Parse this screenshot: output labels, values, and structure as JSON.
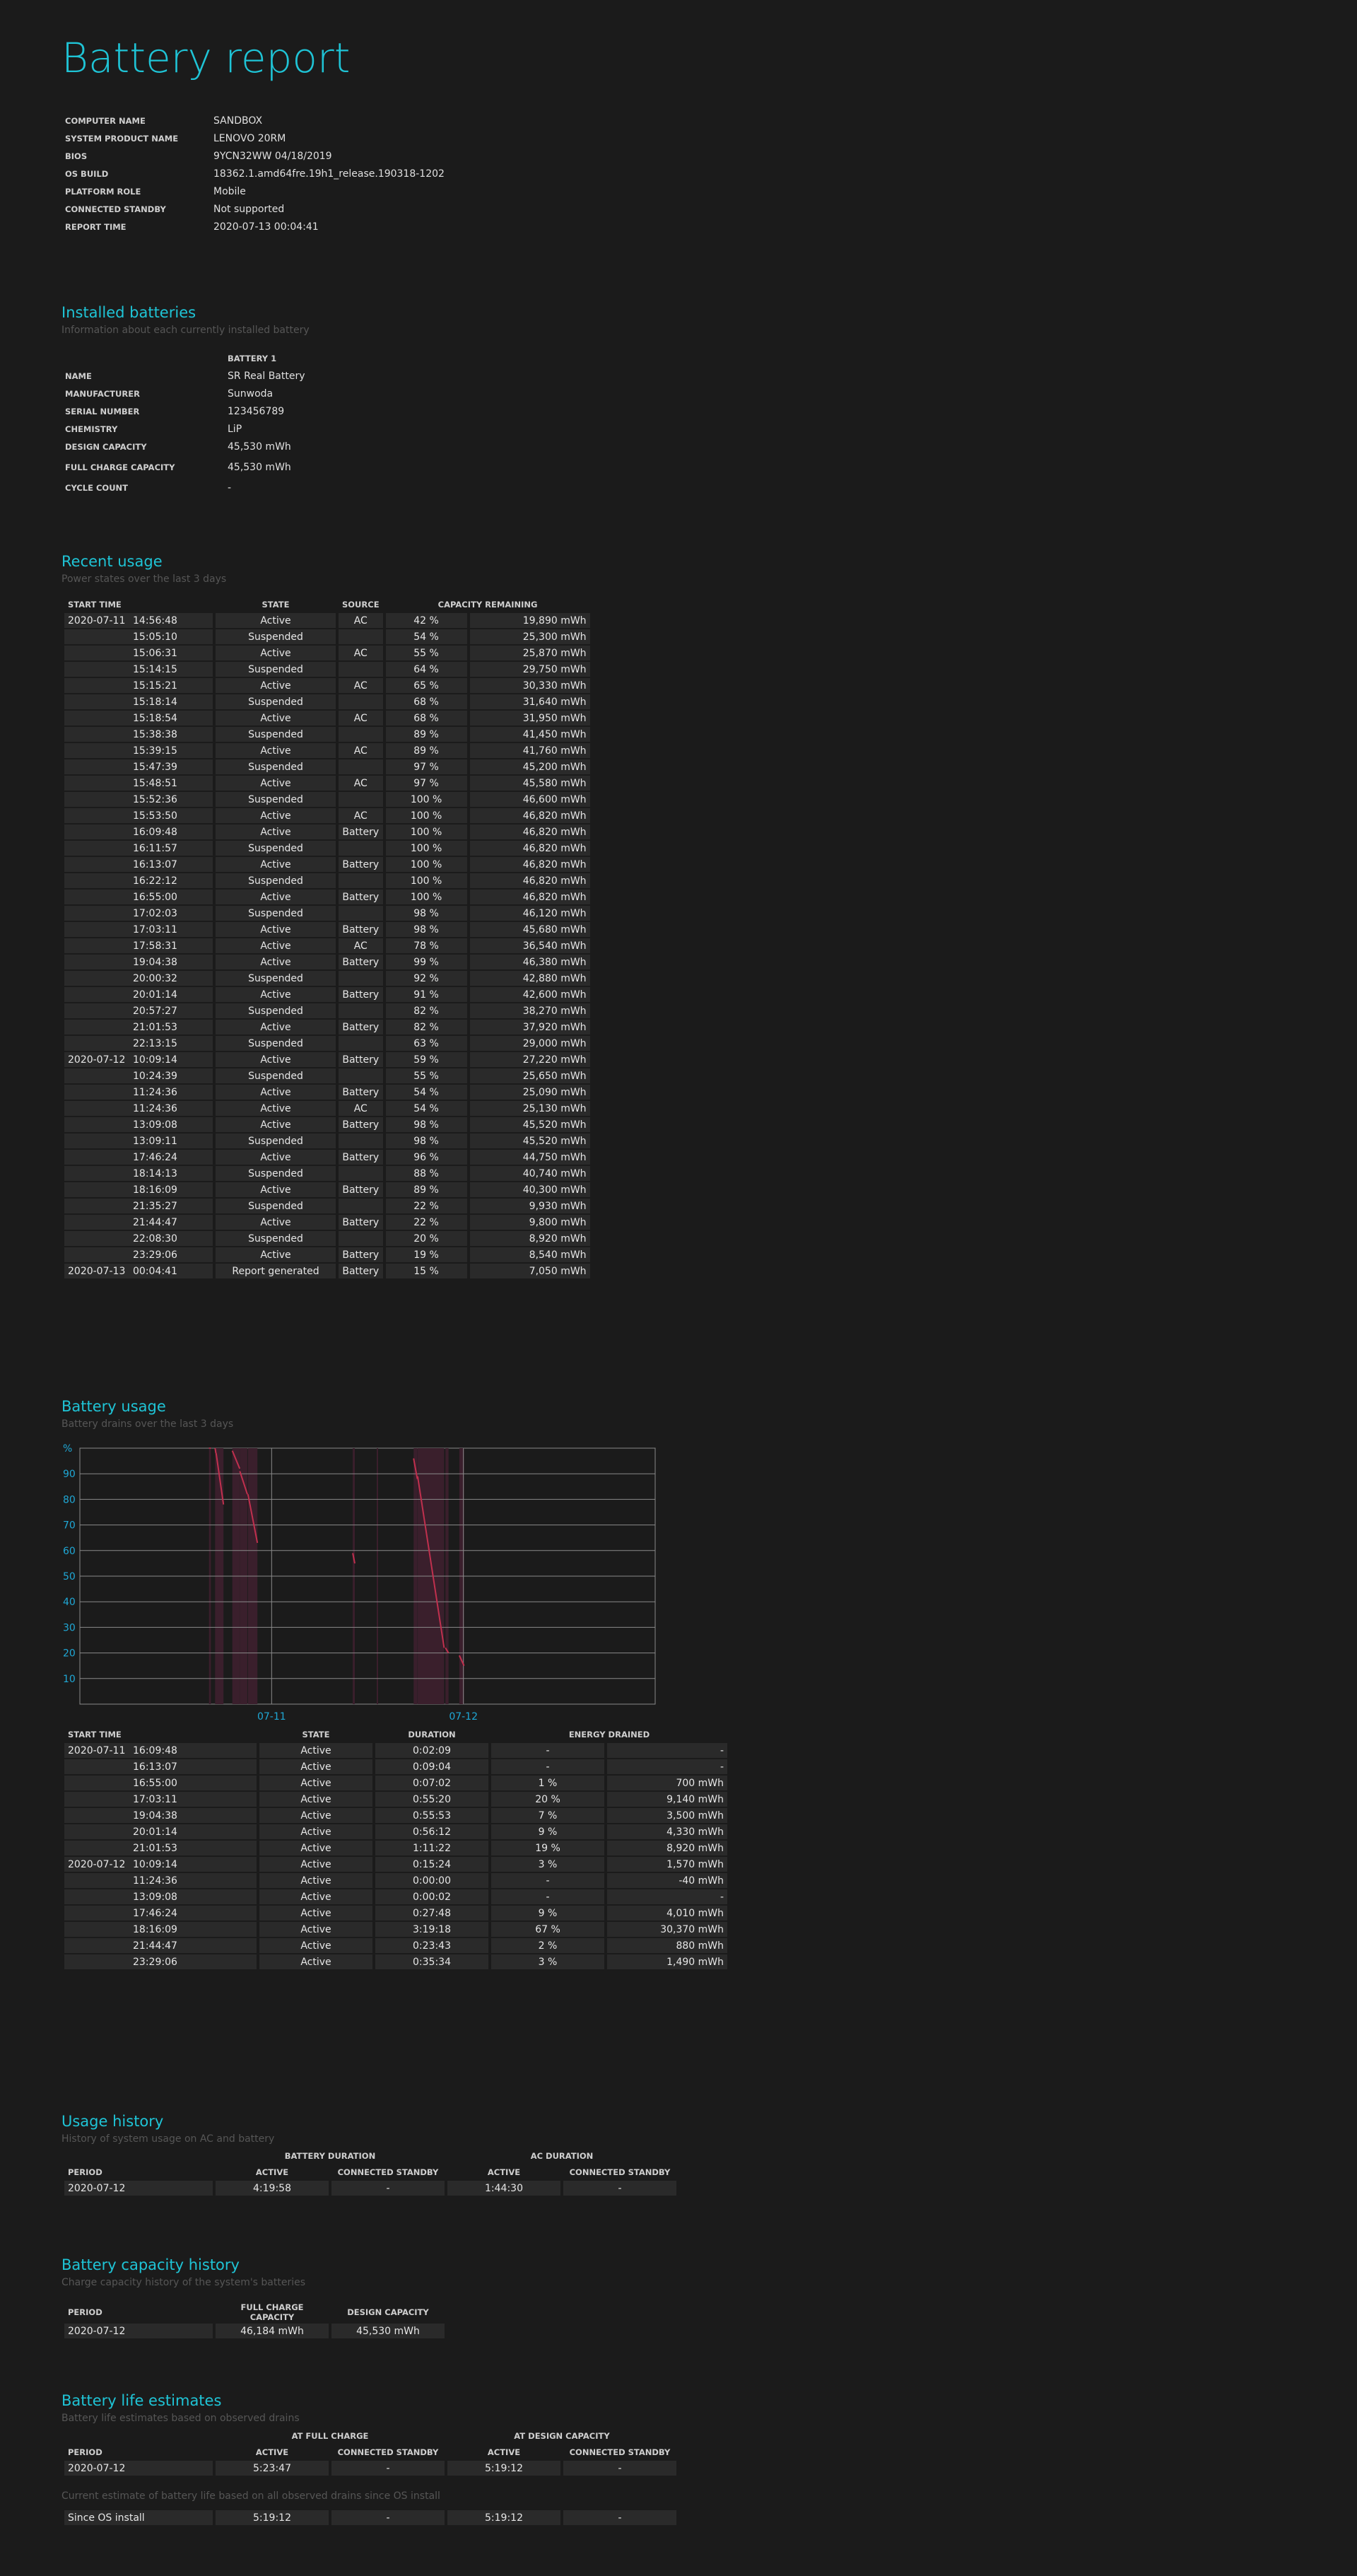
{
  "title": "Battery report",
  "system_info": [
    {
      "label": "COMPUTER NAME",
      "value": "SANDBOX"
    },
    {
      "label": "SYSTEM PRODUCT NAME",
      "value": "LENOVO 20RM"
    },
    {
      "label": "BIOS",
      "value": "9YCN32WW 04/18/2019"
    },
    {
      "label": "OS BUILD",
      "value": "18362.1.amd64fre.19h1_release.190318-1202"
    },
    {
      "label": "PLATFORM ROLE",
      "value": "Mobile"
    },
    {
      "label": "CONNECTED STANDBY",
      "value": "Not supported"
    },
    {
      "label": "REPORT TIME",
      "value": "2020-07-13   00:04:41"
    }
  ],
  "installed": {
    "title": "Installed batteries",
    "subtitle": "Information about each currently installed battery",
    "header": "BATTERY 1",
    "rows": [
      {
        "label": "NAME",
        "value": "SR Real Battery"
      },
      {
        "label": "MANUFACTURER",
        "value": "Sunwoda"
      },
      {
        "label": "SERIAL NUMBER",
        "value": "123456789"
      },
      {
        "label": "CHEMISTRY",
        "value": "LiP"
      },
      {
        "label": "DESIGN CAPACITY",
        "value": "45,530 mWh"
      },
      {
        "label": "FULL CHARGE CAPACITY",
        "value": "45,530 mWh"
      },
      {
        "label": "CYCLE COUNT",
        "value": "-"
      }
    ]
  },
  "recent": {
    "title": "Recent usage",
    "subtitle": "Power states over the last 3 days",
    "headers": [
      "START TIME",
      "STATE",
      "SOURCE",
      "CAPACITY REMAINING"
    ],
    "rows": [
      {
        "date": "2020-07-11",
        "time": "14:56:48",
        "state": "Active",
        "source": "AC",
        "pct": "42 %",
        "mwh": "19,890 mWh"
      },
      {
        "date": "",
        "time": "15:05:10",
        "state": "Suspended",
        "source": "",
        "pct": "54 %",
        "mwh": "25,300 mWh"
      },
      {
        "date": "",
        "time": "15:06:31",
        "state": "Active",
        "source": "AC",
        "pct": "55 %",
        "mwh": "25,870 mWh"
      },
      {
        "date": "",
        "time": "15:14:15",
        "state": "Suspended",
        "source": "",
        "pct": "64 %",
        "mwh": "29,750 mWh"
      },
      {
        "date": "",
        "time": "15:15:21",
        "state": "Active",
        "source": "AC",
        "pct": "65 %",
        "mwh": "30,330 mWh"
      },
      {
        "date": "",
        "time": "15:18:14",
        "state": "Suspended",
        "source": "",
        "pct": "68 %",
        "mwh": "31,640 mWh"
      },
      {
        "date": "",
        "time": "15:18:54",
        "state": "Active",
        "source": "AC",
        "pct": "68 %",
        "mwh": "31,950 mWh"
      },
      {
        "date": "",
        "time": "15:38:38",
        "state": "Suspended",
        "source": "",
        "pct": "89 %",
        "mwh": "41,450 mWh"
      },
      {
        "date": "",
        "time": "15:39:15",
        "state": "Active",
        "source": "AC",
        "pct": "89 %",
        "mwh": "41,760 mWh"
      },
      {
        "date": "",
        "time": "15:47:39",
        "state": "Suspended",
        "source": "",
        "pct": "97 %",
        "mwh": "45,200 mWh"
      },
      {
        "date": "",
        "time": "15:48:51",
        "state": "Active",
        "source": "AC",
        "pct": "97 %",
        "mwh": "45,580 mWh"
      },
      {
        "date": "",
        "time": "15:52:36",
        "state": "Suspended",
        "source": "",
        "pct": "100 %",
        "mwh": "46,600 mWh"
      },
      {
        "date": "",
        "time": "15:53:50",
        "state": "Active",
        "source": "AC",
        "pct": "100 %",
        "mwh": "46,820 mWh"
      },
      {
        "date": "",
        "time": "16:09:48",
        "state": "Active",
        "source": "Battery",
        "pct": "100 %",
        "mwh": "46,820 mWh"
      },
      {
        "date": "",
        "time": "16:11:57",
        "state": "Suspended",
        "source": "",
        "pct": "100 %",
        "mwh": "46,820 mWh"
      },
      {
        "date": "",
        "time": "16:13:07",
        "state": "Active",
        "source": "Battery",
        "pct": "100 %",
        "mwh": "46,820 mWh"
      },
      {
        "date": "",
        "time": "16:22:12",
        "state": "Suspended",
        "source": "",
        "pct": "100 %",
        "mwh": "46,820 mWh"
      },
      {
        "date": "",
        "time": "16:55:00",
        "state": "Active",
        "source": "Battery",
        "pct": "100 %",
        "mwh": "46,820 mWh"
      },
      {
        "date": "",
        "time": "17:02:03",
        "state": "Suspended",
        "source": "",
        "pct": "98 %",
        "mwh": "46,120 mWh"
      },
      {
        "date": "",
        "time": "17:03:11",
        "state": "Active",
        "source": "Battery",
        "pct": "98 %",
        "mwh": "45,680 mWh"
      },
      {
        "date": "",
        "time": "17:58:31",
        "state": "Active",
        "source": "AC",
        "pct": "78 %",
        "mwh": "36,540 mWh"
      },
      {
        "date": "",
        "time": "19:04:38",
        "state": "Active",
        "source": "Battery",
        "pct": "99 %",
        "mwh": "46,380 mWh"
      },
      {
        "date": "",
        "time": "20:00:32",
        "state": "Suspended",
        "source": "",
        "pct": "92 %",
        "mwh": "42,880 mWh"
      },
      {
        "date": "",
        "time": "20:01:14",
        "state": "Active",
        "source": "Battery",
        "pct": "91 %",
        "mwh": "42,600 mWh"
      },
      {
        "date": "",
        "time": "20:57:27",
        "state": "Suspended",
        "source": "",
        "pct": "82 %",
        "mwh": "38,270 mWh"
      },
      {
        "date": "",
        "time": "21:01:53",
        "state": "Active",
        "source": "Battery",
        "pct": "82 %",
        "mwh": "37,920 mWh"
      },
      {
        "date": "",
        "time": "22:13:15",
        "state": "Suspended",
        "source": "",
        "pct": "63 %",
        "mwh": "29,000 mWh"
      },
      {
        "date": "2020-07-12",
        "time": "10:09:14",
        "state": "Active",
        "source": "Battery",
        "pct": "59 %",
        "mwh": "27,220 mWh"
      },
      {
        "date": "",
        "time": "10:24:39",
        "state": "Suspended",
        "source": "",
        "pct": "55 %",
        "mwh": "25,650 mWh"
      },
      {
        "date": "",
        "time": "11:24:36",
        "state": "Active",
        "source": "Battery",
        "pct": "54 %",
        "mwh": "25,090 mWh"
      },
      {
        "date": "",
        "time": "11:24:36",
        "state": "Active",
        "source": "AC",
        "pct": "54 %",
        "mwh": "25,130 mWh"
      },
      {
        "date": "",
        "time": "13:09:08",
        "state": "Active",
        "source": "Battery",
        "pct": "98 %",
        "mwh": "45,520 mWh"
      },
      {
        "date": "",
        "time": "13:09:11",
        "state": "Suspended",
        "source": "",
        "pct": "98 %",
        "mwh": "45,520 mWh"
      },
      {
        "date": "",
        "time": "17:46:24",
        "state": "Active",
        "source": "Battery",
        "pct": "96 %",
        "mwh": "44,750 mWh"
      },
      {
        "date": "",
        "time": "18:14:13",
        "state": "Suspended",
        "source": "",
        "pct": "88 %",
        "mwh": "40,740 mWh"
      },
      {
        "date": "",
        "time": "18:16:09",
        "state": "Active",
        "source": "Battery",
        "pct": "89 %",
        "mwh": "40,300 mWh"
      },
      {
        "date": "",
        "time": "21:35:27",
        "state": "Suspended",
        "source": "",
        "pct": "22 %",
        "mwh": "9,930 mWh"
      },
      {
        "date": "",
        "time": "21:44:47",
        "state": "Active",
        "source": "Battery",
        "pct": "22 %",
        "mwh": "9,800 mWh"
      },
      {
        "date": "",
        "time": "22:08:30",
        "state": "Suspended",
        "source": "",
        "pct": "20 %",
        "mwh": "8,920 mWh"
      },
      {
        "date": "",
        "time": "23:29:06",
        "state": "Active",
        "source": "Battery",
        "pct": "19 %",
        "mwh": "8,540 mWh"
      },
      {
        "date": "2020-07-13",
        "time": "00:04:41",
        "state": "Report generated",
        "source": "Battery",
        "pct": "15 %",
        "mwh": "7,050 mWh"
      }
    ]
  },
  "usage": {
    "title": "Battery usage",
    "subtitle": "Battery drains over the last 3 days",
    "headers": [
      "START TIME",
      "STATE",
      "DURATION",
      "ENERGY DRAINED"
    ],
    "rows": [
      {
        "date": "2020-07-11",
        "time": "16:09:48",
        "state": "Active",
        "duration": "0:02:09",
        "pct": "-",
        "mwh": "-"
      },
      {
        "date": "",
        "time": "16:13:07",
        "state": "Active",
        "duration": "0:09:04",
        "pct": "-",
        "mwh": "-"
      },
      {
        "date": "",
        "time": "16:55:00",
        "state": "Active",
        "duration": "0:07:02",
        "pct": "1 %",
        "mwh": "700 mWh"
      },
      {
        "date": "",
        "time": "17:03:11",
        "state": "Active",
        "duration": "0:55:20",
        "pct": "20 %",
        "mwh": "9,140 mWh"
      },
      {
        "date": "",
        "time": "19:04:38",
        "state": "Active",
        "duration": "0:55:53",
        "pct": "7 %",
        "mwh": "3,500 mWh"
      },
      {
        "date": "",
        "time": "20:01:14",
        "state": "Active",
        "duration": "0:56:12",
        "pct": "9 %",
        "mwh": "4,330 mWh"
      },
      {
        "date": "",
        "time": "21:01:53",
        "state": "Active",
        "duration": "1:11:22",
        "pct": "19 %",
        "mwh": "8,920 mWh"
      },
      {
        "date": "2020-07-12",
        "time": "10:09:14",
        "state": "Active",
        "duration": "0:15:24",
        "pct": "3 %",
        "mwh": "1,570 mWh"
      },
      {
        "date": "",
        "time": "11:24:36",
        "state": "Active",
        "duration": "0:00:00",
        "pct": "-",
        "mwh": "-40 mWh"
      },
      {
        "date": "",
        "time": "13:09:08",
        "state": "Active",
        "duration": "0:00:02",
        "pct": "-",
        "mwh": "-"
      },
      {
        "date": "",
        "time": "17:46:24",
        "state": "Active",
        "duration": "0:27:48",
        "pct": "9 %",
        "mwh": "4,010 mWh"
      },
      {
        "date": "",
        "time": "18:16:09",
        "state": "Active",
        "duration": "3:19:18",
        "pct": "67 %",
        "mwh": "30,370 mWh"
      },
      {
        "date": "",
        "time": "21:44:47",
        "state": "Active",
        "duration": "0:23:43",
        "pct": "2 %",
        "mwh": "880 mWh"
      },
      {
        "date": "",
        "time": "23:29:06",
        "state": "Active",
        "duration": "0:35:34",
        "pct": "3 %",
        "mwh": "1,490 mWh"
      }
    ]
  },
  "chart_data": {
    "type": "line",
    "ylabel": "%",
    "ylim": [
      0,
      100
    ],
    "yticks": [
      10,
      20,
      30,
      40,
      50,
      60,
      70,
      80,
      90
    ],
    "xticks": [
      "07-11",
      "07-12"
    ],
    "xlim_hours": [
      0,
      72
    ],
    "grid": true,
    "line_color": "#c0304e",
    "shade_color": "#3a1f2c",
    "series": [
      {
        "points": [
          [
            16.16,
            100
          ],
          [
            16.2,
            100
          ]
        ]
      },
      {
        "points": [
          [
            16.22,
            100
          ],
          [
            16.37,
            100
          ]
        ]
      },
      {
        "points": [
          [
            16.92,
            100
          ],
          [
            17.03,
            98
          ]
        ]
      },
      {
        "points": [
          [
            17.05,
            98
          ],
          [
            17.97,
            78
          ]
        ]
      },
      {
        "points": [
          [
            19.08,
            99
          ],
          [
            20.01,
            92
          ]
        ]
      },
      {
        "points": [
          [
            20.02,
            91
          ],
          [
            20.96,
            82
          ]
        ]
      },
      {
        "points": [
          [
            21.03,
            82
          ],
          [
            22.22,
            63
          ]
        ]
      },
      {
        "points": [
          [
            34.15,
            59
          ],
          [
            34.41,
            55
          ]
        ]
      },
      {
        "points": [
          [
            35.41,
            54
          ],
          [
            35.41,
            54
          ]
        ]
      },
      {
        "points": [
          [
            37.15,
            98
          ],
          [
            37.15,
            98
          ]
        ]
      },
      {
        "points": [
          [
            41.77,
            96
          ],
          [
            42.24,
            88
          ]
        ]
      },
      {
        "points": [
          [
            42.27,
            89
          ],
          [
            45.59,
            22
          ]
        ]
      },
      {
        "points": [
          [
            45.75,
            22
          ],
          [
            46.14,
            20
          ]
        ]
      },
      {
        "points": [
          [
            47.49,
            19
          ],
          [
            48.08,
            15
          ]
        ]
      }
    ],
    "shaded": [
      [
        16.16,
        16.2
      ],
      [
        16.22,
        16.37
      ],
      [
        16.92,
        17.03
      ],
      [
        17.05,
        17.97
      ],
      [
        19.08,
        20.01
      ],
      [
        20.02,
        20.96
      ],
      [
        21.03,
        22.22
      ],
      [
        34.15,
        34.41
      ],
      [
        37.15,
        37.2
      ],
      [
        41.77,
        42.24
      ],
      [
        42.27,
        45.59
      ],
      [
        45.75,
        46.14
      ],
      [
        47.49,
        48.08
      ]
    ]
  },
  "usage_history": {
    "title": "Usage history",
    "subtitle": "History of system usage on AC and battery",
    "group1": "BATTERY DURATION",
    "group2": "AC DURATION",
    "headers": [
      "PERIOD",
      "ACTIVE",
      "CONNECTED STANDBY",
      "ACTIVE",
      "CONNECTED STANDBY"
    ],
    "row": [
      "2020-07-12",
      "4:19:58",
      "-",
      "1:44:30",
      "-"
    ]
  },
  "capacity_history": {
    "title": "Battery capacity history",
    "subtitle": "Charge capacity history of the system's batteries",
    "headers": [
      "PERIOD",
      "FULL CHARGE CAPACITY",
      "DESIGN CAPACITY"
    ],
    "row": [
      "2020-07-12",
      "46,184 mWh",
      "45,530 mWh"
    ]
  },
  "life_estimates": {
    "title": "Battery life estimates",
    "subtitle": "Battery life estimates based on observed drains",
    "group1": "AT FULL CHARGE",
    "group2": "AT DESIGN CAPACITY",
    "headers": [
      "PERIOD",
      "ACTIVE",
      "CONNECTED STANDBY",
      "ACTIVE",
      "CONNECTED STANDBY"
    ],
    "row": [
      "2020-07-12",
      "5:23:47",
      "-",
      "5:19:12",
      "-"
    ],
    "note": "Current estimate of battery life based on all observed drains since OS install",
    "row2": [
      "Since OS install",
      "5:19:12",
      "-",
      "5:19:12",
      "-"
    ]
  }
}
